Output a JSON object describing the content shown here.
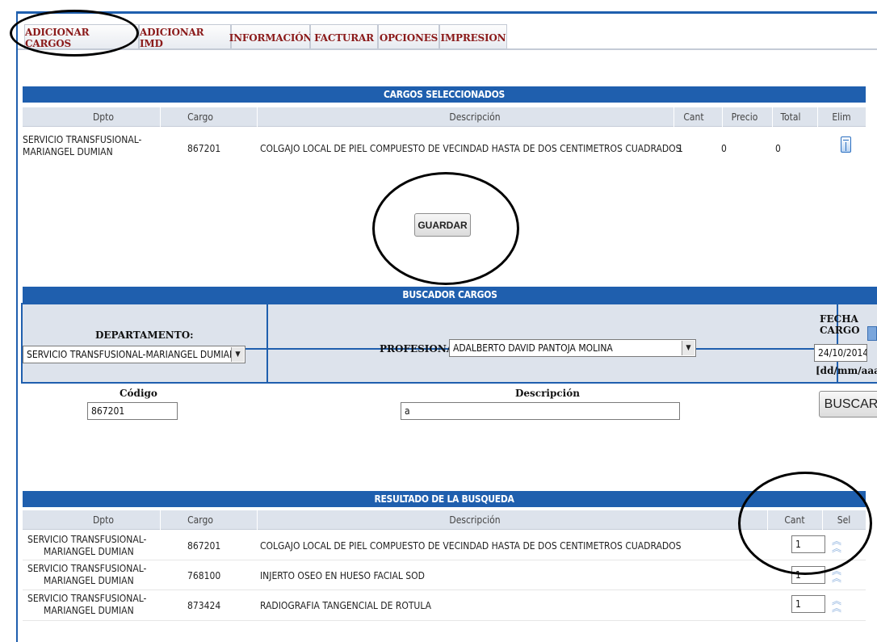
{
  "tabs": [
    "ADICIONAR CARGOS",
    "ADICIONAR IMD",
    "INFORMACIÓN",
    "FACTURAR",
    "OPCIONES",
    "IMPRESION"
  ],
  "selected": {
    "title": "CARGOS SELECCIONADOS",
    "headers": {
      "dpto": "Dpto",
      "cargo": "Cargo",
      "desc": "Descripción",
      "cant": "Cant",
      "precio": "Precio",
      "total": "Total",
      "elim": "Elim"
    },
    "row": {
      "dpto1": "SERVICIO TRANSFUSIONAL-",
      "dpto2": "MARIANGEL DUMIAN",
      "cargo": "867201",
      "desc": "COLGAJO LOCAL DE PIEL COMPUESTO DE VECINDAD HASTA DE DOS CENTIMETROS CUADRADOS",
      "cant": "1",
      "precio": "0",
      "total": "0"
    },
    "save_label": "GUARDAR"
  },
  "search": {
    "title": "BUSCADOR CARGOS",
    "departamento_label": "DEPARTAMENTO:",
    "departamento_value": "SERVICIO TRANSFUSIONAL-MARIANGEL DUMIAN",
    "profesional_label": "PROFESIONAL:",
    "profesional_value": "ADALBERTO DAVID PANTOJA MOLINA",
    "fecha_label": "FECHA CARGO",
    "fecha_value": "24/10/2014",
    "fecha_hint": "[dd/mm/aaaa",
    "codigo_label": "Código",
    "codigo_value": "867201",
    "descripcion_label": "Descripción",
    "descripcion_value": "a",
    "buscar_label": "BUSCAR"
  },
  "results": {
    "title": "RESULTADO DE LA BUSQUEDA",
    "headers": {
      "dpto": "Dpto",
      "cargo": "Cargo",
      "desc": "Descripción",
      "cant": "Cant",
      "sel": "Sel"
    },
    "rows": [
      {
        "dpto1": "SERVICIO TRANSFUSIONAL-",
        "dpto2": "MARIANGEL DUMIAN",
        "cargo": "867201",
        "desc": "COLGAJO LOCAL DE PIEL COMPUESTO DE VECINDAD HASTA DE DOS CENTIMETROS CUADRADOS",
        "cant": "1"
      },
      {
        "dpto1": "SERVICIO TRANSFUSIONAL-",
        "dpto2": "MARIANGEL DUMIAN",
        "cargo": "768100",
        "desc": "INJERTO OSEO EN HUESO FACIAL SOD",
        "cant": "1"
      },
      {
        "dpto1": "SERVICIO TRANSFUSIONAL-",
        "dpto2": "MARIANGEL DUMIAN",
        "cargo": "873424",
        "desc": "RADIOGRAFIA TANGENCIAL DE ROTULA",
        "cant": "1"
      }
    ]
  },
  "icons": {
    "delete": "trash-icon",
    "select": "double-chevron-up-icon",
    "calendar": "calendar-icon",
    "dropdown": "chevron-down-icon"
  },
  "colors": {
    "accent": "#1f5fae",
    "tab_text": "#8b1a1a",
    "header_bg": "#dde3ec"
  }
}
